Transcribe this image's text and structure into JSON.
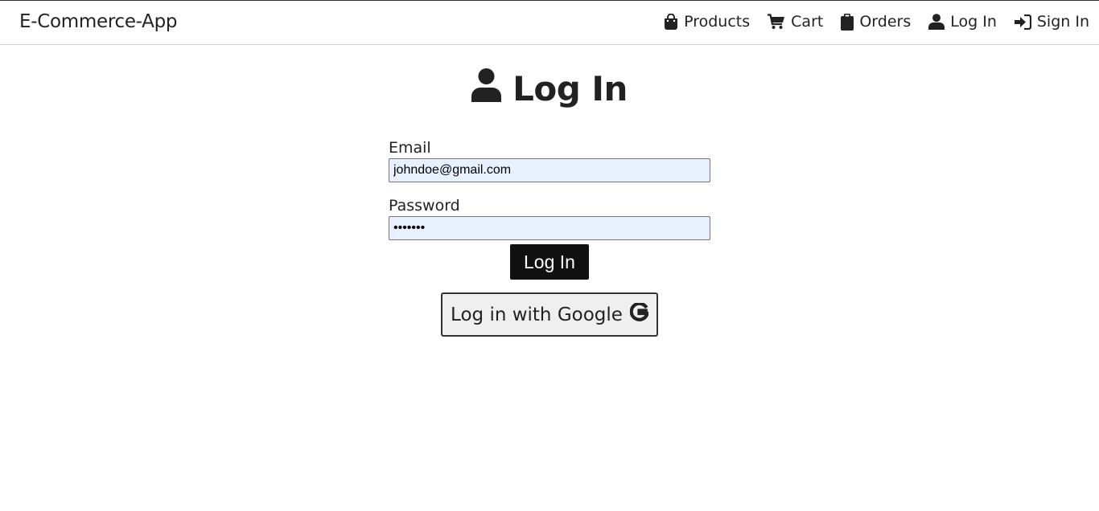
{
  "navbar": {
    "brand": "E-Commerce-App",
    "links": [
      {
        "label": "Products",
        "icon": "shopping-bag-icon"
      },
      {
        "label": "Cart",
        "icon": "cart-icon"
      },
      {
        "label": "Orders",
        "icon": "clipboard-icon"
      },
      {
        "label": "Log In",
        "icon": "user-icon"
      },
      {
        "label": "Sign In",
        "icon": "sign-in-icon"
      }
    ]
  },
  "page": {
    "title": "Log In",
    "title_icon": "user-icon"
  },
  "form": {
    "email_label": "Email",
    "email_value": "johndoe@gmail.com",
    "password_label": "Password",
    "password_value": "•••••••",
    "submit_label": "Log In",
    "google_label": "Log in with Google",
    "google_icon": "google-icon"
  },
  "colors": {
    "autofill_background": "#e8f0fe",
    "primary_button": "#111111",
    "text": "#222222"
  }
}
